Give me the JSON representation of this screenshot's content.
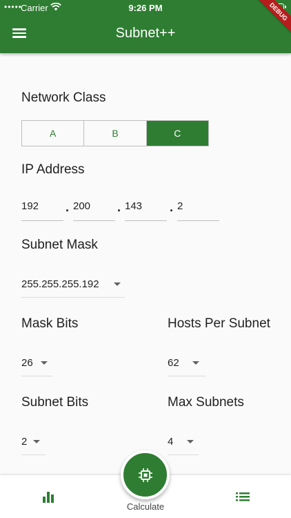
{
  "status_bar": {
    "carrier": "Carrier",
    "time": "9:26 PM"
  },
  "app_bar": {
    "title": "Subnet++",
    "debug_banner": "DEBUG"
  },
  "network_class": {
    "label": "Network Class",
    "options": [
      "A",
      "B",
      "C"
    ],
    "selected": "C"
  },
  "ip_address": {
    "label": "IP Address",
    "octets": [
      "192",
      "200",
      "143",
      "2"
    ],
    "separator": "."
  },
  "subnet_mask": {
    "label": "Subnet Mask",
    "value": "255.255.255.192"
  },
  "mask_bits": {
    "label": "Mask Bits",
    "value": "26"
  },
  "hosts_per_subnet": {
    "label": "Hosts Per Subnet",
    "value": "62"
  },
  "subnet_bits": {
    "label": "Subnet Bits",
    "value": "2"
  },
  "max_subnets": {
    "label": "Max Subnets",
    "value": "4"
  },
  "bottom_nav": {
    "calculate_label": "Calculate"
  },
  "colors": {
    "primary": "#2e7d32",
    "text": "#212121",
    "divider": "#bdbdbd"
  },
  "icons": {
    "menu": "menu-icon",
    "wifi": "wifi-icon",
    "battery": "battery-icon",
    "chart": "bar-chart-icon",
    "cpu": "cpu-chip-icon",
    "list": "list-icon"
  }
}
